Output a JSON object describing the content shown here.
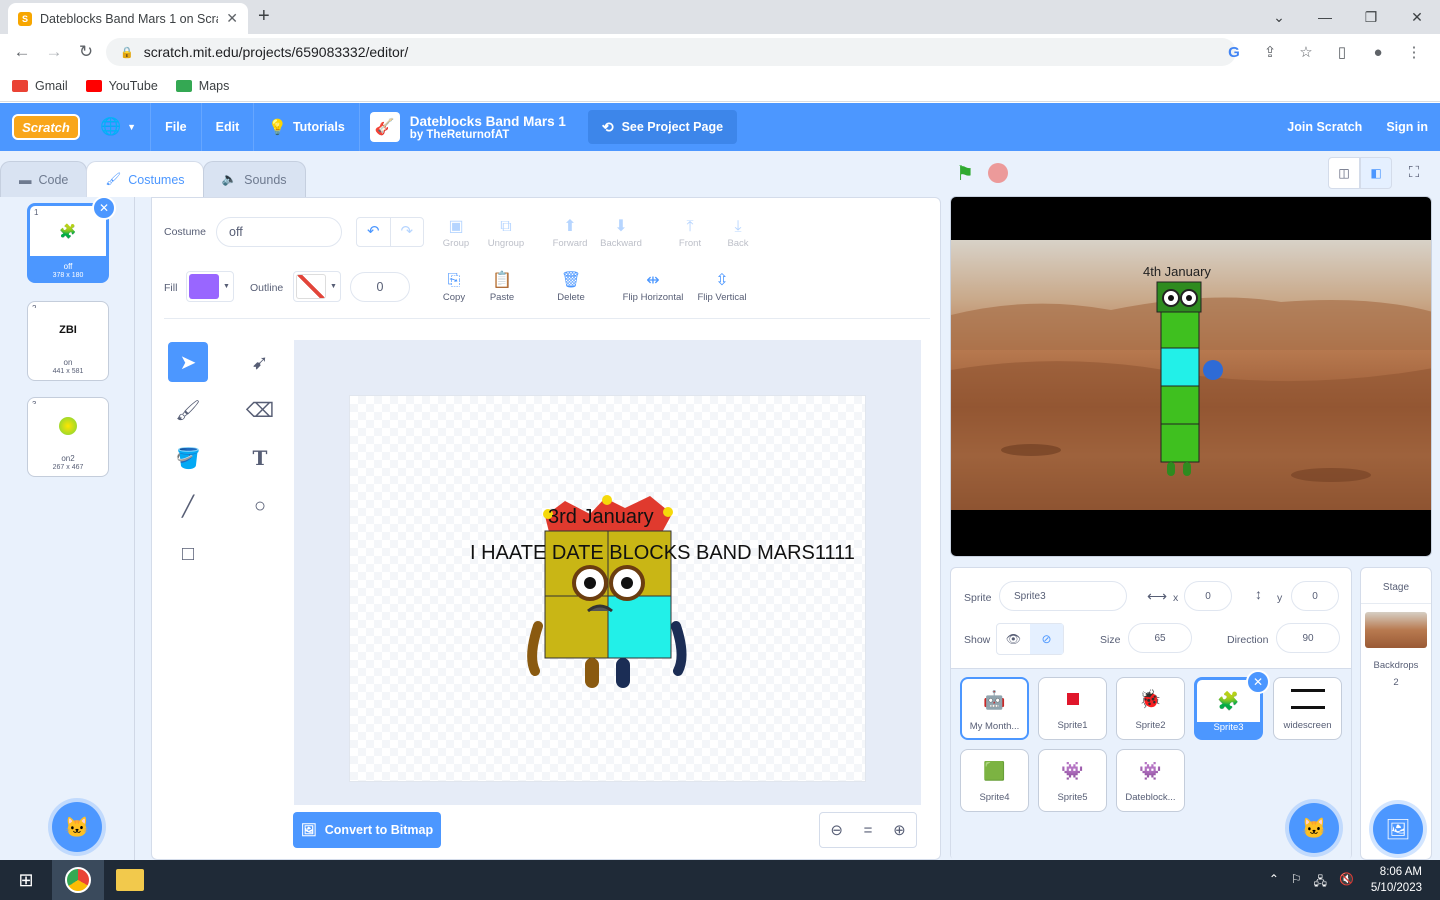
{
  "browser": {
    "tab_title": "Dateblocks Band Mars 1 on Scrat",
    "url": "scratch.mit.edu/projects/659083332/editor/",
    "bookmarks": [
      {
        "label": "Gmail",
        "color": "#ea4335"
      },
      {
        "label": "YouTube",
        "color": "#ff0000"
      },
      {
        "label": "Maps",
        "color": "#34a853"
      }
    ]
  },
  "menubar": {
    "logo": "Scratch",
    "file": "File",
    "edit": "Edit",
    "tutorials": "Tutorials",
    "project_title": "Dateblocks Band Mars 1",
    "project_author": "by TheReturnofAT",
    "see_project": "See Project Page",
    "join": "Join Scratch",
    "signin": "Sign in",
    "bg_color": "#4c97ff"
  },
  "editor_tabs": [
    "Code",
    "Costumes",
    "Sounds"
  ],
  "costumes": [
    {
      "num": "1",
      "name": "off",
      "size": "378 x 180",
      "selected": true
    },
    {
      "num": "2",
      "name": "on",
      "size": "441 x 581",
      "selected": false
    },
    {
      "num": "3",
      "name": "on2",
      "size": "267 x 467",
      "selected": false
    }
  ],
  "paint": {
    "costume_label": "Costume",
    "costume_name": "off",
    "fill_label": "Fill",
    "fill_color": "#9966ff",
    "outline_label": "Outline",
    "outline_width": "0",
    "tools_row1": [
      "Group",
      "Ungroup",
      "Forward",
      "Backward",
      "Front",
      "Back"
    ],
    "tools_row2": [
      "Copy",
      "Paste",
      "Delete",
      "Flip Horizontal",
      "Flip Vertical"
    ],
    "canvas_text1": "3rd January",
    "canvas_text2": "I HAATE DATE BLOCKS BAND MARS1111",
    "convert": "Convert to Bitmap"
  },
  "stage": {
    "text": "4th January"
  },
  "sprite_info": {
    "sprite_label": "Sprite",
    "sprite_name": "Sprite3",
    "x_label": "x",
    "x": "0",
    "y_label": "y",
    "y": "0",
    "show_label": "Show",
    "size_label": "Size",
    "size": "65",
    "direction_label": "Direction",
    "direction": "90"
  },
  "sprites": [
    {
      "name": "My Month...",
      "selected": false
    },
    {
      "name": "Sprite1",
      "selected": false
    },
    {
      "name": "Sprite2",
      "selected": false
    },
    {
      "name": "Sprite3",
      "selected": true
    },
    {
      "name": "widescreen",
      "selected": false
    },
    {
      "name": "Sprite4",
      "selected": false
    },
    {
      "name": "Sprite5",
      "selected": false
    },
    {
      "name": "Dateblock...",
      "selected": false
    }
  ],
  "stage_pane": {
    "title": "Stage",
    "backdrops_label": "Backdrops",
    "backdrops_count": "2"
  },
  "taskbar": {
    "time": "8:06 AM",
    "date": "5/10/2023"
  }
}
